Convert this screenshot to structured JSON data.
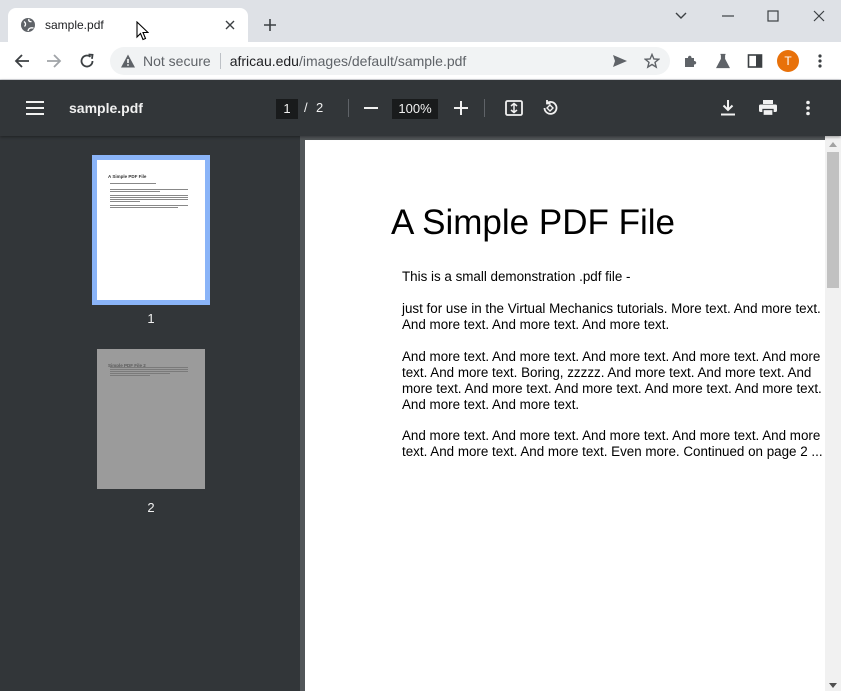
{
  "browser": {
    "tab_title": "sample.pdf",
    "security_label": "Not secure",
    "url_domain": "africau.edu",
    "url_path": "/images/default/sample.pdf",
    "profile_initial": "T",
    "profile_color": "#e8710a"
  },
  "pdf_viewer": {
    "title": "sample.pdf",
    "current_page": "1",
    "page_separator": "/",
    "total_pages": "2",
    "zoom": "100%",
    "thumbnails": [
      {
        "label": "1",
        "mini_title": "A Simple PDF File",
        "selected": true
      },
      {
        "label": "2",
        "mini_title": "Simple PDF File 2",
        "selected": false
      }
    ]
  },
  "document": {
    "heading": "A Simple PDF File",
    "paragraphs": [
      "This is a small demonstration .pdf file -",
      "just for use in the Virtual Mechanics tutorials. More text. And more text. And more text. And more text. And more text.",
      "And more text. And more text. And more text. And more text. And more text. And more text. Boring, zzzzz. And more text. And more text. And more text. And more text. And more text. And more text. And more text. And more text. And more text.",
      "And more text. And more text. And more text. And more text. And more text. And more text. And more text. Even more. Continued on page 2 ..."
    ]
  },
  "colors": {
    "viewer_toolbar": "#323639",
    "thumbnail_selection": "#8ab4f8",
    "viewer_background": "#525659"
  },
  "icons": {
    "tab_favicon": "globe-icon",
    "security": "warning-triangle-icon",
    "send": "send-icon",
    "bookmark": "star-icon",
    "extensions": "puzzle-icon",
    "labs": "flask-icon",
    "side_panel": "side-panel-icon",
    "menu": "kebab-menu-icon"
  }
}
